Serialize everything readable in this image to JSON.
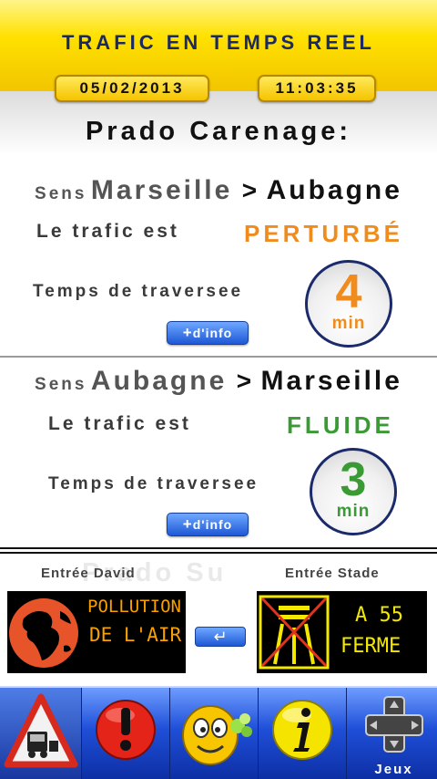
{
  "header": {
    "title": "TRAFIC EN TEMPS REEL",
    "date": "05/02/2013",
    "time": "11:03:35"
  },
  "station": "Prado Carenage:",
  "directions": [
    {
      "sens_word": "Sens",
      "from": "Marseille",
      "separator": ">",
      "to": "Aubagne",
      "traffic_label": "Le trafic est",
      "status": "PERTURBÉ",
      "status_color": "#f08c1e",
      "time_label": "Temps de traversee",
      "minutes": "4",
      "unit": "min",
      "info_label": "d'info",
      "info_plus": "+"
    },
    {
      "sens_word": "Sens",
      "from": "Aubagne",
      "separator": ">",
      "to": "Marseille",
      "traffic_label": "Le trafic est",
      "status": "FLUIDE",
      "status_color": "#3a9a33",
      "time_label": "Temps de traversee",
      "minutes": "3",
      "unit": "min",
      "info_label": "d'info",
      "info_plus": "+"
    }
  ],
  "entrances": {
    "left": {
      "label": "Entrée David",
      "panel_lines": [
        "POLLUTION",
        "DE L'AIR"
      ],
      "panel_color": "#f7a000"
    },
    "right": {
      "label": "Entrée Stade",
      "panel_lines": [
        "A 55",
        "FERME"
      ],
      "panel_color": "#f5e800"
    },
    "ghost_text": "Prado Su",
    "enter_icon": "↵"
  },
  "nav": {
    "items": [
      {
        "icon": "traffic-warning-icon"
      },
      {
        "icon": "alert-icon"
      },
      {
        "icon": "mascot-icon"
      },
      {
        "icon": "info-icon"
      },
      {
        "icon": "dpad-icon",
        "label": "Jeux"
      }
    ]
  },
  "colors": {
    "header_yellow": "#ffe100",
    "title_navy": "#1b2a63",
    "nav_blue": "#1f4fd8",
    "button_blue": "#1e58d6",
    "perturbe_orange": "#f08c1e",
    "fluide_green": "#3a9a33"
  }
}
